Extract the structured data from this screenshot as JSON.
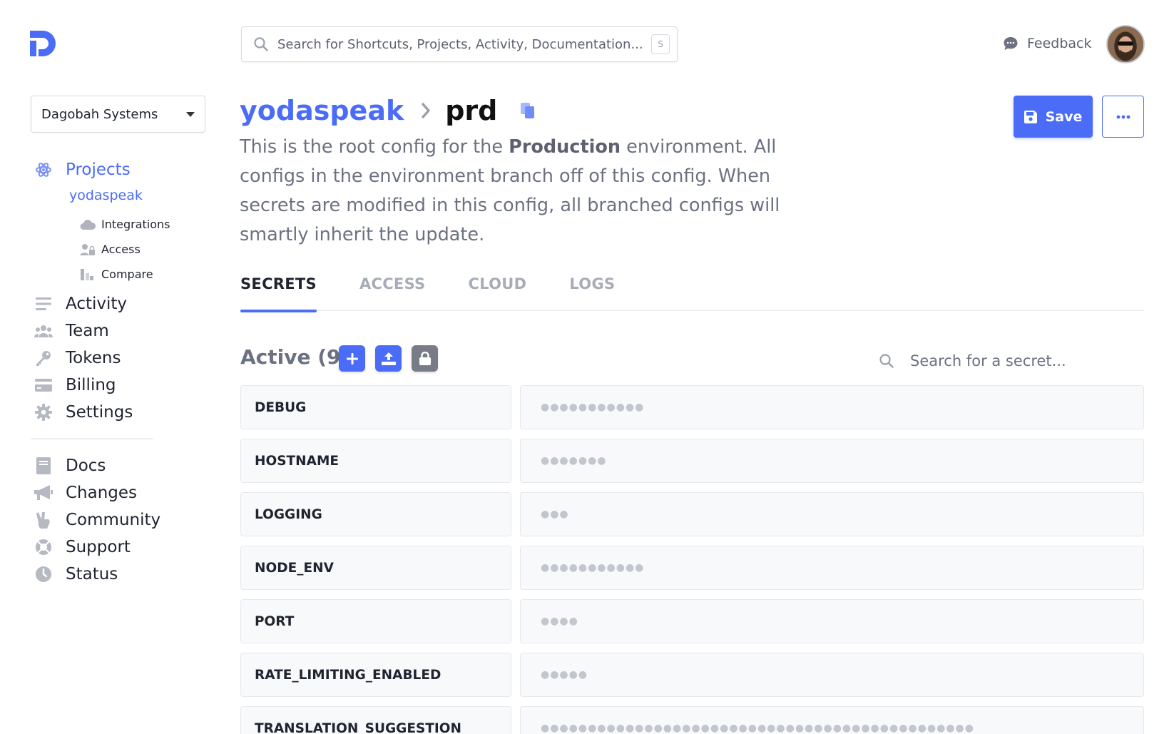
{
  "brand": {
    "accent": "#4a6cf7"
  },
  "search": {
    "placeholder": "Search for Shortcuts, Projects, Activity, Documentation...",
    "shortcut": "S"
  },
  "header": {
    "feedback_label": "Feedback"
  },
  "workplace": {
    "name": "Dagobah Systems"
  },
  "sidebar": {
    "primary": [
      {
        "label": "Projects",
        "icon": "atom-icon",
        "active": true
      },
      {
        "label": "Activity",
        "icon": "list-icon"
      },
      {
        "label": "Team",
        "icon": "users-icon"
      },
      {
        "label": "Tokens",
        "icon": "key-icon"
      },
      {
        "label": "Billing",
        "icon": "credit-card-icon"
      },
      {
        "label": "Settings",
        "icon": "gear-icon"
      }
    ],
    "project": "yodaspeak",
    "project_items": [
      {
        "label": "Integrations",
        "icon": "cloud-icon"
      },
      {
        "label": "Access",
        "icon": "user-lock-icon"
      },
      {
        "label": "Compare",
        "icon": "compare-icon"
      }
    ],
    "secondary": [
      {
        "label": "Docs",
        "icon": "book-icon"
      },
      {
        "label": "Changes",
        "icon": "megaphone-icon"
      },
      {
        "label": "Community",
        "icon": "peace-hand-icon"
      },
      {
        "label": "Support",
        "icon": "lifebuoy-icon"
      },
      {
        "label": "Status",
        "icon": "clock-icon"
      }
    ]
  },
  "page": {
    "project": "yodaspeak",
    "config": "prd",
    "description_pre": "This is the root config for the ",
    "description_bold": "Production",
    "description_post": " environment. All configs in the environment branch off of this config. When secrets are modified in this config, all branched configs will smartly inherit the update.",
    "save_label": "Save"
  },
  "tabs": [
    "SECRETS",
    "ACCESS",
    "CLOUD",
    "LOGS"
  ],
  "secrets": {
    "title": "Active (9)",
    "search_placeholder": "Search for a secret...",
    "rows": [
      {
        "name": "DEBUG",
        "mask": "●●●●●●●●●●●"
      },
      {
        "name": "HOSTNAME",
        "mask": "●●●●●●●"
      },
      {
        "name": "LOGGING",
        "mask": "●●●"
      },
      {
        "name": "NODE_ENV",
        "mask": "●●●●●●●●●●●"
      },
      {
        "name": "PORT",
        "mask": "●●●●"
      },
      {
        "name": "RATE_LIMITING_ENABLED",
        "mask": "●●●●●"
      },
      {
        "name": "TRANSLATION_SUGGESTION",
        "mask": "●●●●●●●●●●●●●●●●●●●●●●●●●●●●●●●●●●●●●●●●●●●●●●"
      }
    ]
  }
}
